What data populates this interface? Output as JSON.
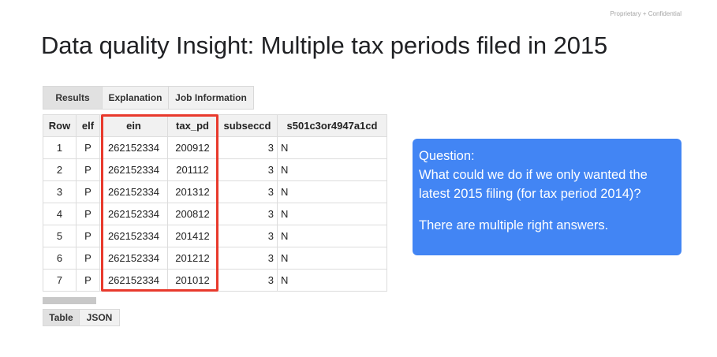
{
  "header": {
    "confidential": "Proprietary + Confidential",
    "title": "Data quality Insight: Multiple tax periods filed in 2015"
  },
  "results_tabs": [
    {
      "label": "Results",
      "active": true
    },
    {
      "label": "Explanation",
      "active": false
    },
    {
      "label": "Job Information",
      "active": false
    }
  ],
  "table": {
    "columns": [
      "Row",
      "elf",
      "ein",
      "tax_pd",
      "subseccd",
      "s501c3or4947a1cd"
    ],
    "rows": [
      [
        "1",
        "P",
        "262152334",
        "200912",
        "3",
        "N"
      ],
      [
        "2",
        "P",
        "262152334",
        "201112",
        "3",
        "N"
      ],
      [
        "3",
        "P",
        "262152334",
        "201312",
        "3",
        "N"
      ],
      [
        "4",
        "P",
        "262152334",
        "200812",
        "3",
        "N"
      ],
      [
        "5",
        "P",
        "262152334",
        "201412",
        "3",
        "N"
      ],
      [
        "6",
        "P",
        "262152334",
        "201212",
        "3",
        "N"
      ],
      [
        "7",
        "P",
        "262152334",
        "201012",
        "3",
        "N"
      ]
    ],
    "highlighted_columns": [
      "ein",
      "tax_pd"
    ],
    "highlight_color": "#e8392c"
  },
  "view_toggle": [
    {
      "label": "Table",
      "active": true
    },
    {
      "label": "JSON",
      "active": false
    }
  ],
  "callout": {
    "heading": "Question:",
    "question": "What could we do if we only wanted the latest 2015 filing (for tax period 2014)?",
    "note": "There are multiple right answers.",
    "background": "#4285f4"
  }
}
